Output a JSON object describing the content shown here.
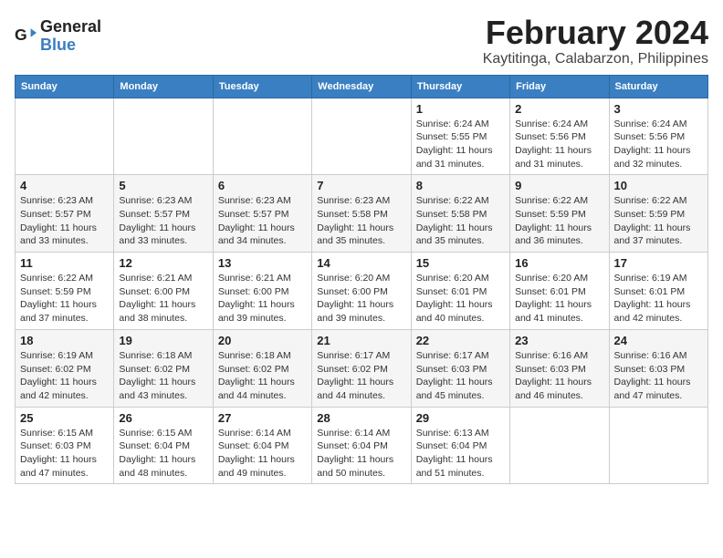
{
  "logo": {
    "line1": "General",
    "line2": "Blue"
  },
  "title": "February 2024",
  "subtitle": "Kaytitinga, Calabarzon, Philippines",
  "headers": [
    "Sunday",
    "Monday",
    "Tuesday",
    "Wednesday",
    "Thursday",
    "Friday",
    "Saturday"
  ],
  "weeks": [
    [
      {
        "day": "",
        "sunrise": "",
        "sunset": "",
        "daylight": ""
      },
      {
        "day": "",
        "sunrise": "",
        "sunset": "",
        "daylight": ""
      },
      {
        "day": "",
        "sunrise": "",
        "sunset": "",
        "daylight": ""
      },
      {
        "day": "",
        "sunrise": "",
        "sunset": "",
        "daylight": ""
      },
      {
        "day": "1",
        "sunrise": "Sunrise: 6:24 AM",
        "sunset": "Sunset: 5:55 PM",
        "daylight": "Daylight: 11 hours and 31 minutes."
      },
      {
        "day": "2",
        "sunrise": "Sunrise: 6:24 AM",
        "sunset": "Sunset: 5:56 PM",
        "daylight": "Daylight: 11 hours and 31 minutes."
      },
      {
        "day": "3",
        "sunrise": "Sunrise: 6:24 AM",
        "sunset": "Sunset: 5:56 PM",
        "daylight": "Daylight: 11 hours and 32 minutes."
      }
    ],
    [
      {
        "day": "4",
        "sunrise": "Sunrise: 6:23 AM",
        "sunset": "Sunset: 5:57 PM",
        "daylight": "Daylight: 11 hours and 33 minutes."
      },
      {
        "day": "5",
        "sunrise": "Sunrise: 6:23 AM",
        "sunset": "Sunset: 5:57 PM",
        "daylight": "Daylight: 11 hours and 33 minutes."
      },
      {
        "day": "6",
        "sunrise": "Sunrise: 6:23 AM",
        "sunset": "Sunset: 5:57 PM",
        "daylight": "Daylight: 11 hours and 34 minutes."
      },
      {
        "day": "7",
        "sunrise": "Sunrise: 6:23 AM",
        "sunset": "Sunset: 5:58 PM",
        "daylight": "Daylight: 11 hours and 35 minutes."
      },
      {
        "day": "8",
        "sunrise": "Sunrise: 6:22 AM",
        "sunset": "Sunset: 5:58 PM",
        "daylight": "Daylight: 11 hours and 35 minutes."
      },
      {
        "day": "9",
        "sunrise": "Sunrise: 6:22 AM",
        "sunset": "Sunset: 5:59 PM",
        "daylight": "Daylight: 11 hours and 36 minutes."
      },
      {
        "day": "10",
        "sunrise": "Sunrise: 6:22 AM",
        "sunset": "Sunset: 5:59 PM",
        "daylight": "Daylight: 11 hours and 37 minutes."
      }
    ],
    [
      {
        "day": "11",
        "sunrise": "Sunrise: 6:22 AM",
        "sunset": "Sunset: 5:59 PM",
        "daylight": "Daylight: 11 hours and 37 minutes."
      },
      {
        "day": "12",
        "sunrise": "Sunrise: 6:21 AM",
        "sunset": "Sunset: 6:00 PM",
        "daylight": "Daylight: 11 hours and 38 minutes."
      },
      {
        "day": "13",
        "sunrise": "Sunrise: 6:21 AM",
        "sunset": "Sunset: 6:00 PM",
        "daylight": "Daylight: 11 hours and 39 minutes."
      },
      {
        "day": "14",
        "sunrise": "Sunrise: 6:20 AM",
        "sunset": "Sunset: 6:00 PM",
        "daylight": "Daylight: 11 hours and 39 minutes."
      },
      {
        "day": "15",
        "sunrise": "Sunrise: 6:20 AM",
        "sunset": "Sunset: 6:01 PM",
        "daylight": "Daylight: 11 hours and 40 minutes."
      },
      {
        "day": "16",
        "sunrise": "Sunrise: 6:20 AM",
        "sunset": "Sunset: 6:01 PM",
        "daylight": "Daylight: 11 hours and 41 minutes."
      },
      {
        "day": "17",
        "sunrise": "Sunrise: 6:19 AM",
        "sunset": "Sunset: 6:01 PM",
        "daylight": "Daylight: 11 hours and 42 minutes."
      }
    ],
    [
      {
        "day": "18",
        "sunrise": "Sunrise: 6:19 AM",
        "sunset": "Sunset: 6:02 PM",
        "daylight": "Daylight: 11 hours and 42 minutes."
      },
      {
        "day": "19",
        "sunrise": "Sunrise: 6:18 AM",
        "sunset": "Sunset: 6:02 PM",
        "daylight": "Daylight: 11 hours and 43 minutes."
      },
      {
        "day": "20",
        "sunrise": "Sunrise: 6:18 AM",
        "sunset": "Sunset: 6:02 PM",
        "daylight": "Daylight: 11 hours and 44 minutes."
      },
      {
        "day": "21",
        "sunrise": "Sunrise: 6:17 AM",
        "sunset": "Sunset: 6:02 PM",
        "daylight": "Daylight: 11 hours and 44 minutes."
      },
      {
        "day": "22",
        "sunrise": "Sunrise: 6:17 AM",
        "sunset": "Sunset: 6:03 PM",
        "daylight": "Daylight: 11 hours and 45 minutes."
      },
      {
        "day": "23",
        "sunrise": "Sunrise: 6:16 AM",
        "sunset": "Sunset: 6:03 PM",
        "daylight": "Daylight: 11 hours and 46 minutes."
      },
      {
        "day": "24",
        "sunrise": "Sunrise: 6:16 AM",
        "sunset": "Sunset: 6:03 PM",
        "daylight": "Daylight: 11 hours and 47 minutes."
      }
    ],
    [
      {
        "day": "25",
        "sunrise": "Sunrise: 6:15 AM",
        "sunset": "Sunset: 6:03 PM",
        "daylight": "Daylight: 11 hours and 47 minutes."
      },
      {
        "day": "26",
        "sunrise": "Sunrise: 6:15 AM",
        "sunset": "Sunset: 6:04 PM",
        "daylight": "Daylight: 11 hours and 48 minutes."
      },
      {
        "day": "27",
        "sunrise": "Sunrise: 6:14 AM",
        "sunset": "Sunset: 6:04 PM",
        "daylight": "Daylight: 11 hours and 49 minutes."
      },
      {
        "day": "28",
        "sunrise": "Sunrise: 6:14 AM",
        "sunset": "Sunset: 6:04 PM",
        "daylight": "Daylight: 11 hours and 50 minutes."
      },
      {
        "day": "29",
        "sunrise": "Sunrise: 6:13 AM",
        "sunset": "Sunset: 6:04 PM",
        "daylight": "Daylight: 11 hours and 51 minutes."
      },
      {
        "day": "",
        "sunrise": "",
        "sunset": "",
        "daylight": ""
      },
      {
        "day": "",
        "sunrise": "",
        "sunset": "",
        "daylight": ""
      }
    ]
  ]
}
